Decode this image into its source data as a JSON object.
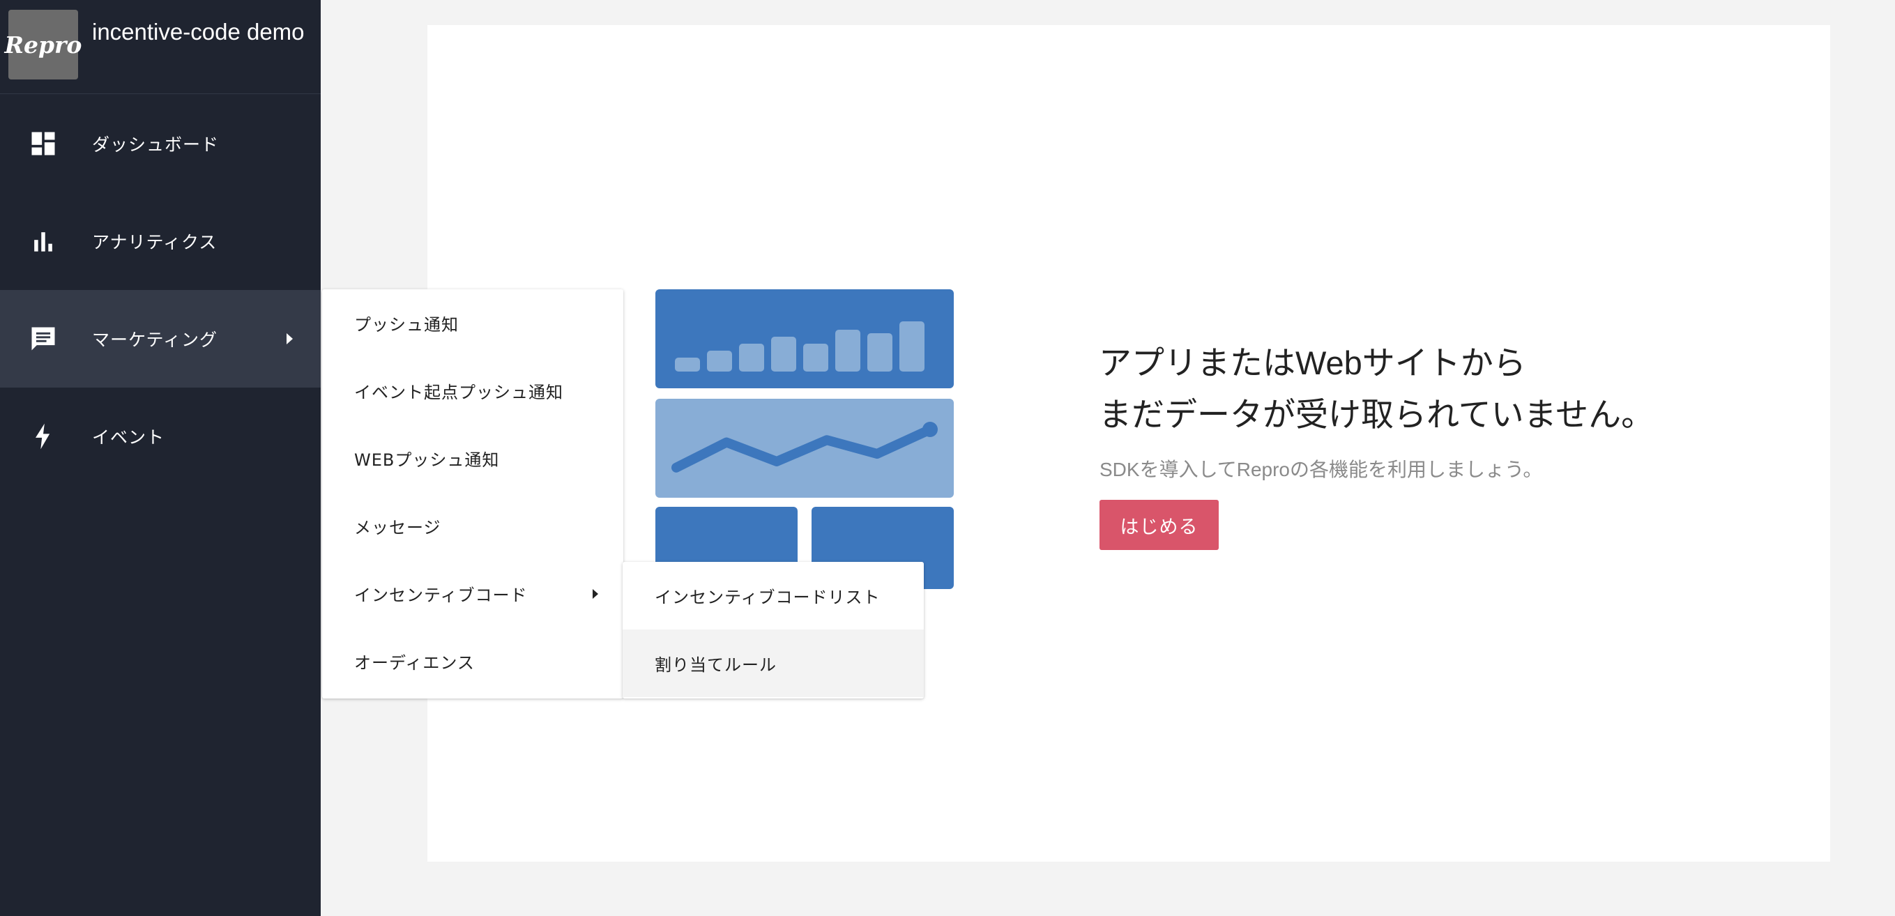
{
  "app": {
    "logo_text": "Repro",
    "name": "incentive-code demo"
  },
  "sidebar": {
    "items": [
      {
        "label": "ダッシュボード",
        "icon": "dashboard-icon"
      },
      {
        "label": "アナリティクス",
        "icon": "bar-chart-icon"
      },
      {
        "label": "マーケティング",
        "icon": "message-icon",
        "active": true
      },
      {
        "label": "イベント",
        "icon": "lightning-icon"
      }
    ]
  },
  "marketing_menu": {
    "items": [
      {
        "label": "プッシュ通知"
      },
      {
        "label": "イベント起点プッシュ通知"
      },
      {
        "label": "WEBプッシュ通知"
      },
      {
        "label": "メッセージ"
      },
      {
        "label": "インセンティブコード",
        "has_submenu": true
      },
      {
        "label": "オーディエンス"
      }
    ]
  },
  "incentive_submenu": {
    "items": [
      {
        "label": "インセンティブコードリスト"
      },
      {
        "label": "割り当てルール",
        "hovered": true
      }
    ]
  },
  "empty_state": {
    "title_line1": "アプリまたはWebサイトから",
    "title_line2": "まだデータが受け取られていません。",
    "subtitle": "SDKを導入してReproの各機能を利用しましょう。",
    "button_label": "はじめる"
  },
  "illustration": {
    "bar_values": [
      0.2,
      0.3,
      0.4,
      0.5,
      0.4,
      0.6,
      0.55,
      0.72
    ],
    "line_values": [
      0.22,
      0.55,
      0.3,
      0.58,
      0.4,
      0.7
    ],
    "colors": {
      "dark": "#3d77bd",
      "light": "#88add6"
    }
  },
  "colors": {
    "sidebar_bg": "#1f2430",
    "sidebar_active": "#343a48",
    "accent_button": "#d9556a"
  }
}
